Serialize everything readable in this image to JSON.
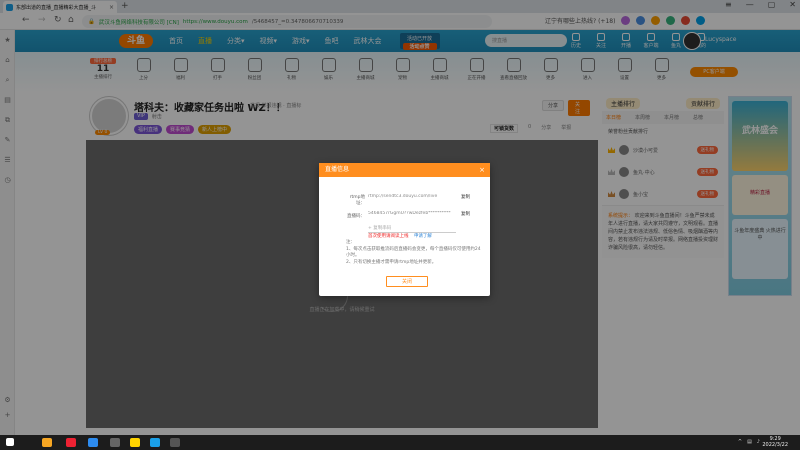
{
  "browser": {
    "tab_title": "东部出道的直播_直播精彩大直播_斗",
    "url_secure_label": "武汉斗鱼网络科技有限公司 [CN]",
    "url_host": "https://www.douyu.com",
    "url_path": "/5468457_=0.347806670710339",
    "news_text": "辽宁有哪些上热线? (+18)",
    "new_tab": "+"
  },
  "leftbar": {
    "items": [
      "★",
      "⌂",
      "⌕",
      "▤",
      "⧉",
      "✎",
      "☰",
      "◷",
      "⚙",
      "+"
    ]
  },
  "topnav": {
    "logo": "斗鱼",
    "menu": [
      "首页",
      "直播",
      "分类▾",
      "视频▾",
      "游戏▾",
      "鱼吧",
      "武林大会"
    ],
    "active_index": 1,
    "promo_line1": "活动已开放",
    "promo_line2": "活动点赞",
    "search_placeholder": "搜直播",
    "right_items": [
      "历史",
      "关注",
      "开播",
      "客户端",
      "鱼丸",
      "我的"
    ],
    "username": "Lucyspace"
  },
  "banner": {
    "rank_label": "排行总榜",
    "rank_value": "11",
    "rank_sub": "主播排行",
    "tools": [
      "上分",
      "福利",
      "打手",
      "粉丝团",
      "礼物",
      "娱乐",
      "主播商城",
      "宠物",
      "主播商城",
      "正在开播",
      "查看直播回放",
      "更多",
      "进入",
      "设置",
      "更多"
    ],
    "pc_button": "PC客户端"
  },
  "streamer": {
    "level": "LV 0",
    "title": "塔科夫：收藏家任务出啦 WZ！！",
    "report": "举报  举报违规 · 直播标",
    "vip": "VIP",
    "category": "射击",
    "tags": [
      "福利直播",
      "赛事竞猜",
      "新人上榜中"
    ],
    "share": "分享",
    "follow": "关注",
    "bar_keyword": "可锁货数",
    "bar_count": "0",
    "bar_items": [
      "分享",
      "举报"
    ]
  },
  "player": {
    "loading_tip": "直播正在加载中，请稍候重试"
  },
  "side": {
    "rank_a": "主播排行",
    "rank_b": "贡献排行",
    "tabs": [
      "本日榜",
      "本周榜",
      "本月榜",
      "总榜"
    ],
    "fans_header": "荣誉粉丝贡献排行",
    "fans": [
      {
        "name": "沙漠小可爱",
        "btn": "送礼物"
      },
      {
        "name": "鱼丸·中心",
        "btn": "送礼物"
      },
      {
        "name": "鱼小宝",
        "btn": "送礼物"
      }
    ],
    "notice_sys": "系统提示：",
    "notice_text": "欢迎来到斗鱼直播间！斗鱼严禁未成年人进行直播，请大家共同遵守，文明观看。直播间内禁止发布违法违规、低俗色情、吸烟酗酒等内容，若有违规行为请及时举报。网络直播投资理财诈骗风险很高，请勿轻信。"
  },
  "ads": {
    "ad1": "武林盛会",
    "ad2": "精彩直播",
    "ad3": "斗鱼年度盛典 火热进行中"
  },
  "dialog": {
    "title": "直播信息",
    "close": "×",
    "rtmp_label": "rtmp地址：",
    "rtmp_value": "rtmp://sendtc3.douyu.com/live",
    "copy": "复制",
    "key_label": "直播码：",
    "key_value": "5468457rGgmU??wDezfeb**********",
    "key_placeholder": "+ 复制串码",
    "warn": "首次使用请阅读上线",
    "more": "申请了解",
    "notes": "注：\n1、每次点击获取推流码后直播码会变更，每个直播码仅可使用约24小时。\n2、只有切换主播才需申请rtmp地址并更新。",
    "ok": "关闭"
  },
  "taskbar": {
    "time": "9:29",
    "date": "2022/3/22"
  }
}
